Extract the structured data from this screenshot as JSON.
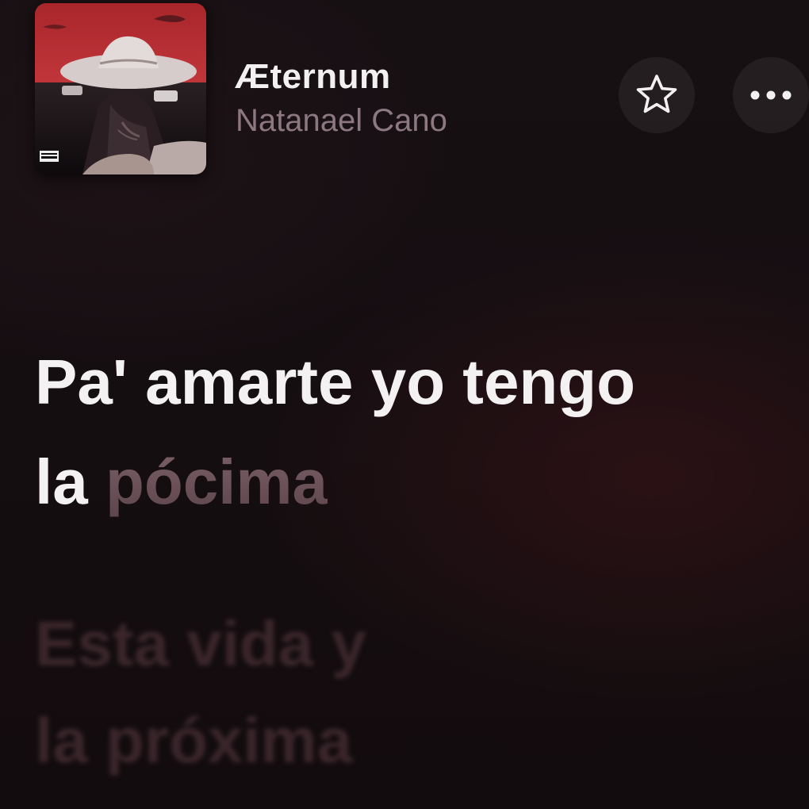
{
  "track": {
    "title": "Æternum",
    "artist": "Natanael Cano",
    "album_art_label": "PARENTAL ADVISORY EXPLICIT CONTENT"
  },
  "controls": {
    "favorite_icon": "star-icon",
    "more_icon": "ellipsis-icon"
  },
  "lyrics": {
    "current_line_1": "Pa' amarte yo tengo",
    "current_line_2_sung": "la ",
    "current_line_2_pending": "pócima",
    "next_line_1": "Esta vida y",
    "next_line_2": "la próxima"
  },
  "colors": {
    "background": "#120c0e",
    "active_lyric": "#f4f1f2",
    "pending_lyric": "#6e555b",
    "upcoming_lyric": "#3a262b",
    "artist_text": "#8d7780"
  }
}
